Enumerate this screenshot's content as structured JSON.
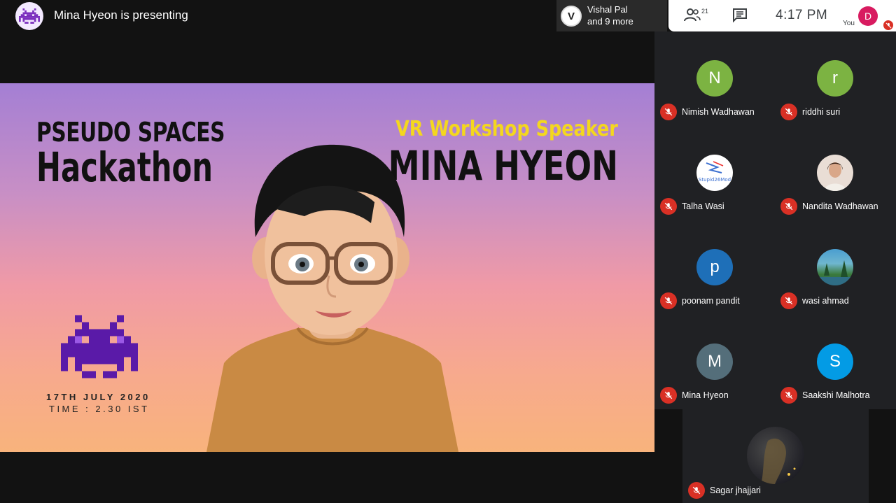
{
  "header": {
    "presenting_text": "Mina Hyeon is presenting",
    "join_notice": {
      "name": "Vishal Pal",
      "more": "and 9 more"
    },
    "people_count": "21",
    "clock": "4:17 PM",
    "self_initial": "D",
    "self_label": "You"
  },
  "slide": {
    "title_line1": "PSEUDO SPACES",
    "title_line2": "Hackathon",
    "role": "VR Workshop Speaker",
    "speaker": "MINA HYEON",
    "date": "17TH JULY 2020",
    "time": "TIME : 2.30 IST"
  },
  "participants": [
    {
      "name": "Nimish Wadhawan",
      "initial": "N",
      "color": "#7cb342",
      "muted": true
    },
    {
      "name": "riddhi suri",
      "initial": "r",
      "color": "#7cb342",
      "muted": true
    },
    {
      "name": "Talha Wasi",
      "initial": "",
      "color": "#ffffff",
      "muted": true
    },
    {
      "name": "Nandita Wadhawan",
      "initial": "",
      "color": "#e9ddd5",
      "muted": true
    },
    {
      "name": "poonam pandit",
      "initial": "p",
      "color": "#1e6fb8",
      "muted": true
    },
    {
      "name": "wasi ahmad",
      "initial": "",
      "color": "#3e8fa8",
      "muted": true
    },
    {
      "name": "Mina Hyeon",
      "initial": "M",
      "color": "#546e7a",
      "muted": true
    },
    {
      "name": "Saakshi Malhotra",
      "initial": "S",
      "color": "#039be5",
      "muted": true
    }
  ],
  "bottom_participant": {
    "name": "Sagar jhajjari",
    "muted": true
  },
  "talha_logo_text": "Stupid26Mod"
}
